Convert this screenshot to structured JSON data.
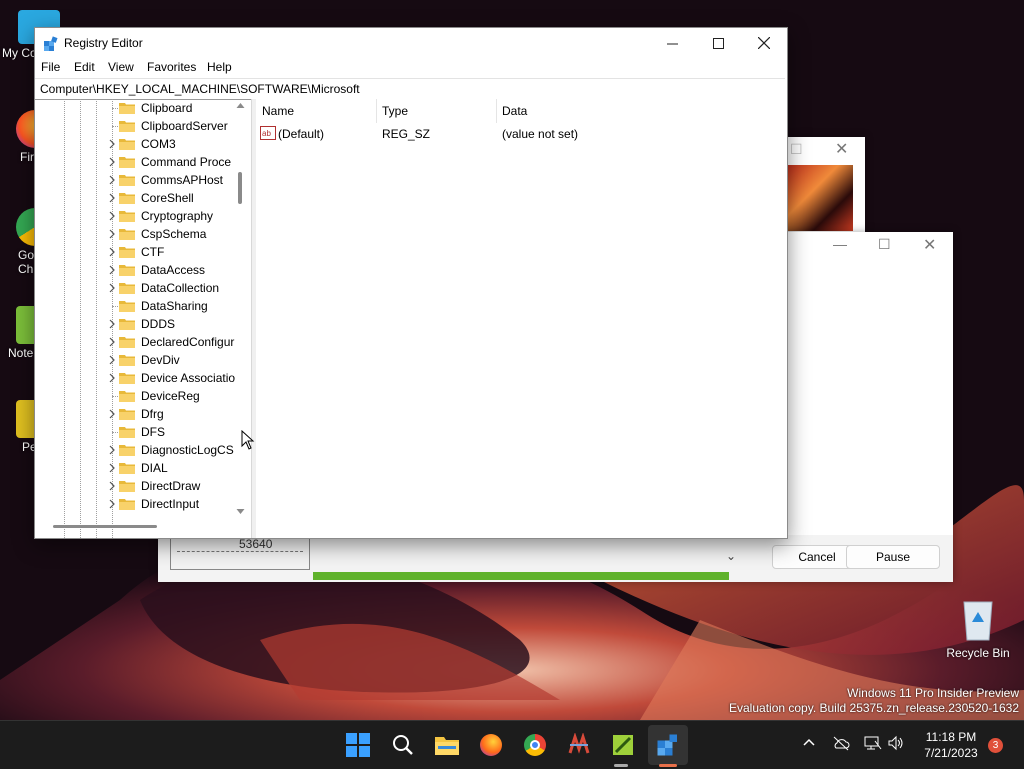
{
  "desktop": {
    "icons": [
      {
        "label": "My Co",
        "icon": "computer-icon"
      },
      {
        "label": "Fir",
        "icon": "firefox-icon"
      },
      {
        "label": "Go Chi",
        "icon": "chrome-icon"
      },
      {
        "label": "Note",
        "icon": "notepad-plus-icon"
      },
      {
        "label": "Pe",
        "icon": "shortcut-icon"
      }
    ],
    "recycle_bin": "Recycle Bin",
    "watermark_line1": "Windows 11 Pro Insider Preview",
    "watermark_line2": "Evaluation copy. Build 25375.zn_release.230520-1632"
  },
  "regedit": {
    "title": "Registry Editor",
    "menu": [
      "File",
      "Edit",
      "View",
      "Favorites",
      "Help"
    ],
    "address": "Computer\\HKEY_LOCAL_MACHINE\\SOFTWARE\\Microsoft",
    "tree": [
      {
        "name": "Clipboard",
        "expandable": false
      },
      {
        "name": "ClipboardServer",
        "expandable": false
      },
      {
        "name": "COM3",
        "expandable": true
      },
      {
        "name": "Command Proce",
        "expandable": true
      },
      {
        "name": "CommsAPHost",
        "expandable": true
      },
      {
        "name": "CoreShell",
        "expandable": true
      },
      {
        "name": "Cryptography",
        "expandable": true
      },
      {
        "name": "CspSchema",
        "expandable": true
      },
      {
        "name": "CTF",
        "expandable": true
      },
      {
        "name": "DataAccess",
        "expandable": true
      },
      {
        "name": "DataCollection",
        "expandable": true
      },
      {
        "name": "DataSharing",
        "expandable": false
      },
      {
        "name": "DDDS",
        "expandable": true
      },
      {
        "name": "DeclaredConfigur",
        "expandable": true
      },
      {
        "name": "DevDiv",
        "expandable": true
      },
      {
        "name": "Device Associatio",
        "expandable": true
      },
      {
        "name": "DeviceReg",
        "expandable": false
      },
      {
        "name": "Dfrg",
        "expandable": true
      },
      {
        "name": "DFS",
        "expandable": false
      },
      {
        "name": "DiagnosticLogCS",
        "expandable": true
      },
      {
        "name": "DIAL",
        "expandable": true
      },
      {
        "name": "DirectDraw",
        "expandable": true
      },
      {
        "name": "DirectInput",
        "expandable": true
      }
    ],
    "columns": [
      "Name",
      "Type",
      "Data"
    ],
    "values": [
      {
        "name": "(Default)",
        "type": "REG_SZ",
        "data": "(value not set)",
        "icon": "string-value-icon"
      }
    ]
  },
  "progress_dialog": {
    "count": "53640",
    "cancel_label": "Cancel",
    "pause_label": "Pause",
    "progress": 0.8,
    "accent": "#5fb22b"
  },
  "taskbar": {
    "apps": [
      "start-icon",
      "search-icon",
      "file-explorer-icon",
      "firefox-icon",
      "chrome-icon",
      "app-icon",
      "notepad-plus-icon",
      "regedit-icon"
    ],
    "time": "11:18 PM",
    "date": "7/21/2023",
    "notification_count": "3"
  }
}
